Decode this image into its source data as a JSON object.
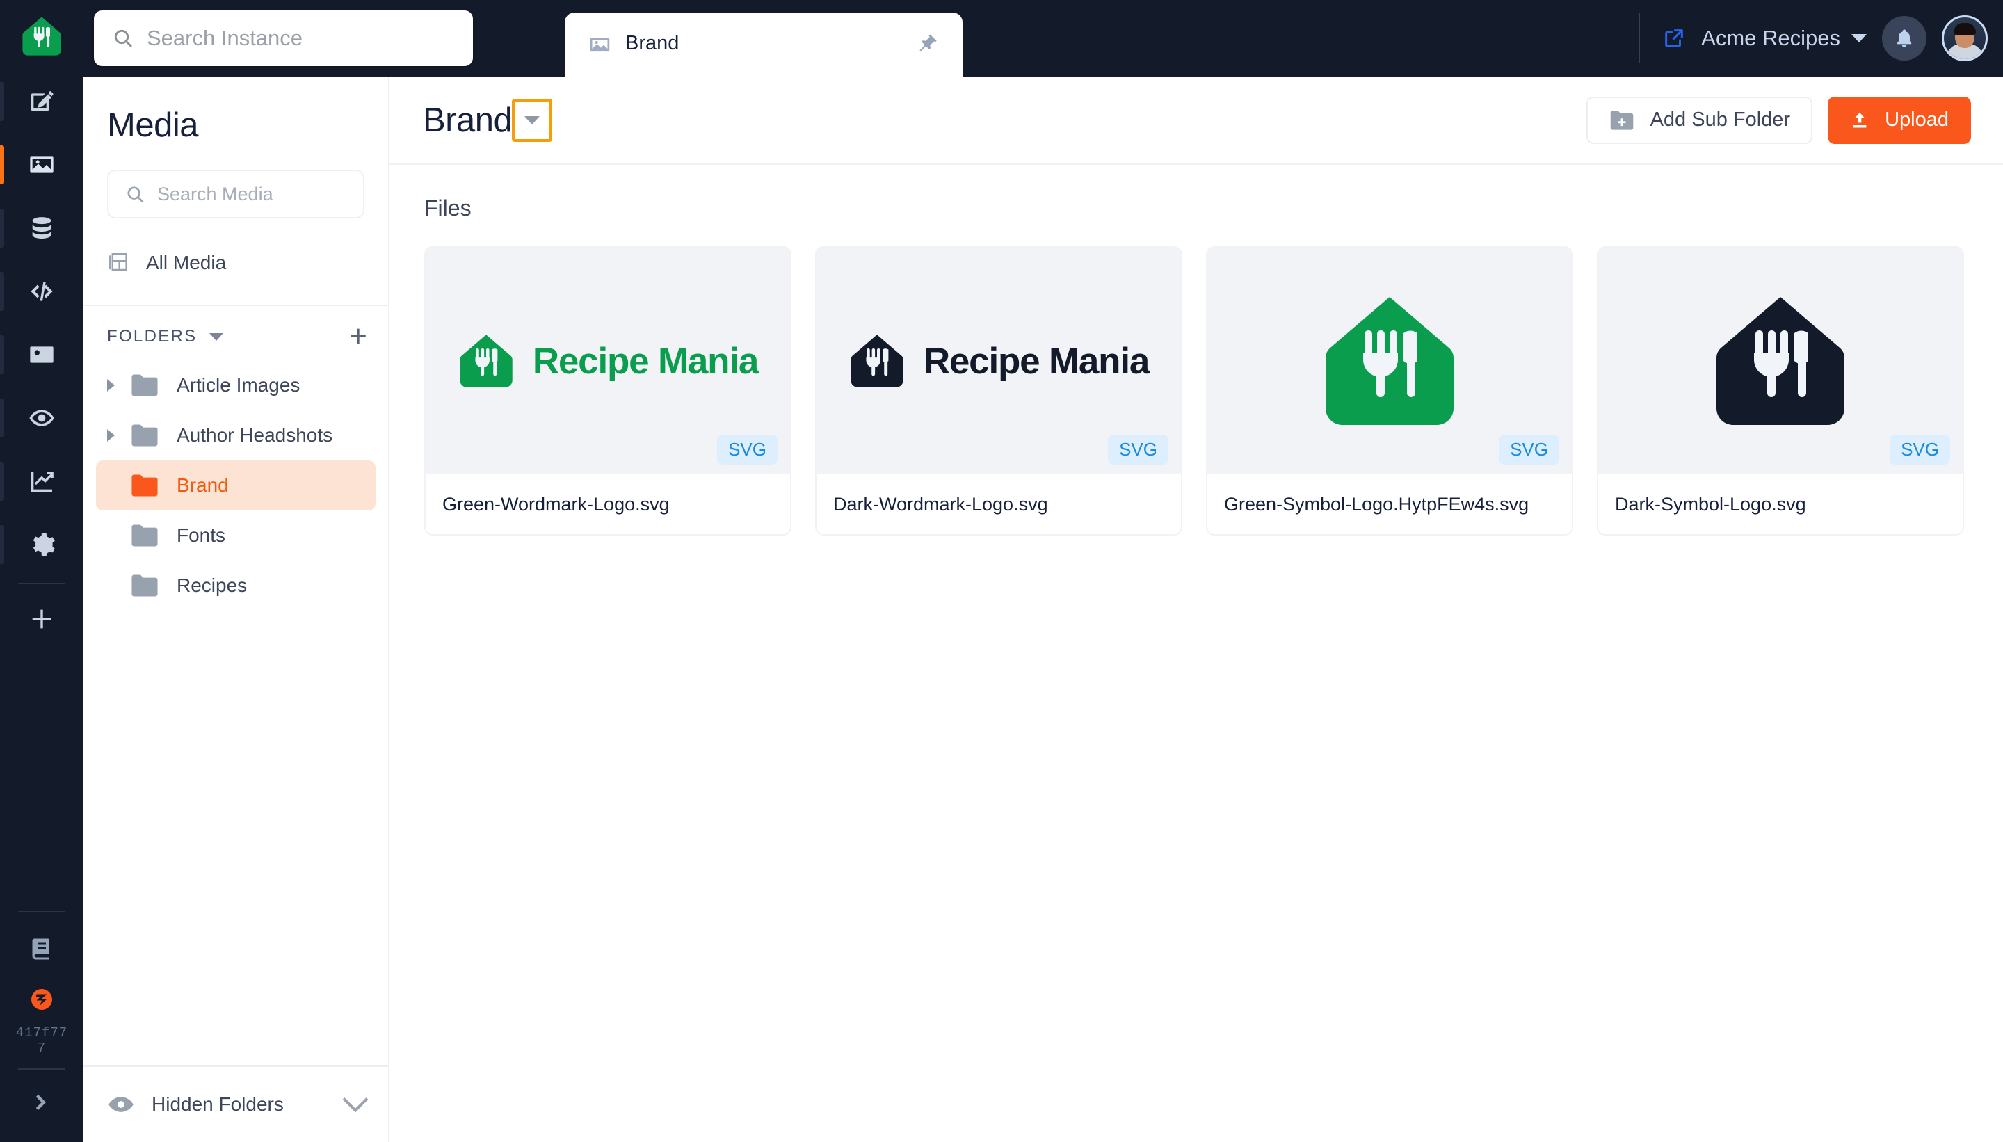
{
  "brand": {
    "accent_orange": "#f9571b",
    "dark_navy": "#131a29",
    "logo_green": "#0a9d4e",
    "badge_blue": "#1a8ce0"
  },
  "topbar": {
    "search_placeholder": "Search Instance",
    "search_value": "",
    "search_icon": "search-icon",
    "external_link_icon": "external-link-icon",
    "org_name": "Acme Recipes",
    "org_caret_icon": "chevron-down-icon",
    "bell_icon": "bell-icon",
    "avatar_icon": "user-avatar"
  },
  "tabs": [
    {
      "label": "Brand",
      "icon": "image-icon",
      "pin_icon": "pin-icon",
      "active": true
    }
  ],
  "icon_rail": {
    "logo_icon": "recipe-mania-logo",
    "items": [
      {
        "name": "sidebar-item-content",
        "icon": "compose-edit-icon",
        "active": false
      },
      {
        "name": "sidebar-item-media",
        "icon": "image-icon",
        "active": true
      },
      {
        "name": "sidebar-item-data",
        "icon": "database-icon",
        "active": false
      },
      {
        "name": "sidebar-item-code",
        "icon": "code-icon",
        "active": false
      },
      {
        "name": "sidebar-item-contacts",
        "icon": "contact-card-icon",
        "active": false
      },
      {
        "name": "sidebar-item-preview",
        "icon": "eye-target-icon",
        "active": false
      },
      {
        "name": "sidebar-item-analytics",
        "icon": "chart-line-icon",
        "active": false
      },
      {
        "name": "sidebar-item-settings",
        "icon": "gear-icon",
        "active": false
      },
      {
        "name": "sidebar-item-add",
        "icon": "plus-icon",
        "active": false
      }
    ],
    "bottom": {
      "docs_icon": "book-icon",
      "zesty_icon": "zesty-logo-icon",
      "version": "417f777",
      "expand_icon": "chevron-right-icon"
    }
  },
  "media_sidebar": {
    "title": "Media",
    "search_placeholder": "Search Media",
    "search_value": "",
    "search_icon": "search-icon",
    "all_media": {
      "label": "All Media",
      "icon": "grid-layout-icon"
    },
    "folders_header": {
      "label": "FOLDERS",
      "collapse_icon": "chevron-down-icon",
      "add_icon": "plus-icon"
    },
    "folders": [
      {
        "label": "Article Images",
        "expandable": true,
        "selected": false
      },
      {
        "label": "Author Headshots",
        "expandable": true,
        "selected": false
      },
      {
        "label": "Brand",
        "expandable": false,
        "selected": true
      },
      {
        "label": "Fonts",
        "expandable": false,
        "selected": false
      },
      {
        "label": "Recipes",
        "expandable": false,
        "selected": false
      }
    ],
    "hidden_folders": {
      "label": "Hidden Folders",
      "eye_icon": "eye-icon",
      "chevron_icon": "chevron-down-icon"
    }
  },
  "main": {
    "heading": "Brand",
    "heading_dropdown_icon": "caret-down-icon",
    "heading_dropdown_highlighted": true,
    "add_sub_folder": {
      "label": "Add Sub Folder",
      "icon": "folder-plus-icon"
    },
    "upload": {
      "label": "Upload",
      "icon": "upload-icon"
    },
    "files_section_label": "Files",
    "files": [
      {
        "name": "Green-Wordmark-Logo.svg",
        "type_badge": "SVG",
        "preview": "wordmark",
        "color": "#0a9d4e",
        "wordmark_text": "Recipe Mania"
      },
      {
        "name": "Dark-Wordmark-Logo.svg",
        "type_badge": "SVG",
        "preview": "wordmark",
        "color": "#131a29",
        "wordmark_text": "Recipe Mania"
      },
      {
        "name": "Green-Symbol-Logo.HytpFEw4s.svg",
        "type_badge": "SVG",
        "preview": "symbol",
        "color": "#0a9d4e",
        "wordmark_text": ""
      },
      {
        "name": "Dark-Symbol-Logo.svg",
        "type_badge": "SVG",
        "preview": "symbol",
        "color": "#131a29",
        "wordmark_text": ""
      }
    ]
  }
}
